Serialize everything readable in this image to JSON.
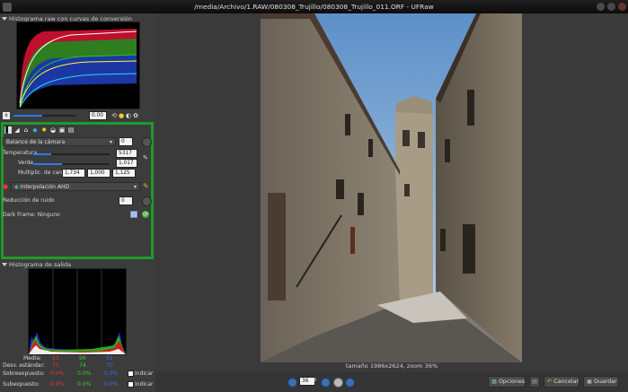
{
  "window": {
    "title": "/media/Archivo/1.RAW/080308_Trujillo/080308_Trujillo_011.ORF - UFRaw"
  },
  "raw_histogram": {
    "header": "Histograma raw con curvas de conversión"
  },
  "exposure": {
    "value": "0.00"
  },
  "white_balance": {
    "preset": "Balance de la cámara",
    "preset_index": "0",
    "temperature_label": "Temperatura",
    "temperature_value": "5317",
    "green_label": "Verde",
    "green_value": "1.017",
    "multipliers_label": "Multiplic. de canal",
    "multipliers": [
      "1,734",
      "1,000",
      "1,125"
    ]
  },
  "interpolation": {
    "selected": "Interpolación AHD"
  },
  "noise": {
    "label": "Reducción de ruido",
    "value": "0"
  },
  "dark_frame": {
    "label": "Dark Frame:",
    "value": "Ninguno"
  },
  "output_histogram": {
    "header": "Histograma de salida"
  },
  "stats": {
    "media_label": "Media:",
    "media": [
      "53",
      "96",
      "92"
    ],
    "desv_label": "Desv. estándar:",
    "desv": [
      "75",
      "74",
      "70"
    ],
    "sobre_label": "Sobreexpuesto:",
    "sobre": [
      "0.0%",
      "0.0%",
      "0.0%"
    ],
    "sobre_check": "Indicar",
    "sub_label": "Subexpuesto:",
    "sub": [
      "0.0%",
      "0.0%",
      "0.0%"
    ],
    "sub_check": "Indicar"
  },
  "image_info": {
    "caption": "tamaño 1986x2624, zoom 36%"
  },
  "toolbar": {
    "zoom": "36",
    "options_label": "Opciones",
    "cancel_label": "Cancelar",
    "save_label": "Guardar"
  },
  "colors": {
    "accent": "#2a7be8",
    "highlight_frame": "#1f9a2c"
  }
}
